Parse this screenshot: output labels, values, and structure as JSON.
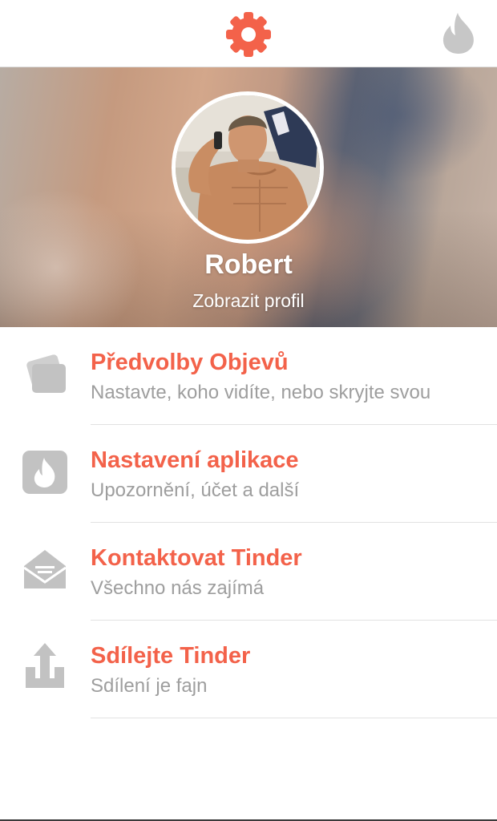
{
  "topbar": {
    "settings_icon": "gear-icon",
    "tinder_icon": "flame-icon",
    "accent_color": "#f3624a",
    "inactive_color": "#c7c7c7"
  },
  "profile": {
    "name": "Robert",
    "view_profile": "Zobrazit profil"
  },
  "menu": {
    "items": [
      {
        "title": "Předvolby Objevů",
        "subtitle": "Nastavte, koho vidíte, nebo skryjte svou",
        "icon": "cards-icon"
      },
      {
        "title": "Nastavení aplikace",
        "subtitle": "Upozornění, účet a další",
        "icon": "flame-square-icon"
      },
      {
        "title": "Kontaktovat Tinder",
        "subtitle": "Všechno nás zajímá",
        "icon": "envelope-icon"
      },
      {
        "title": "Sdílejte Tinder",
        "subtitle": "Sdílení je fajn",
        "icon": "share-icon"
      }
    ]
  }
}
